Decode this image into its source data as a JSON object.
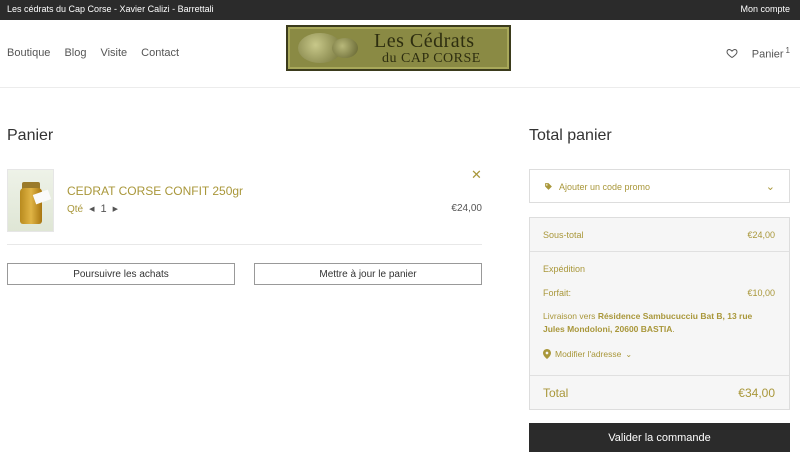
{
  "topbar": {
    "site_title": "Les cédrats du Cap Corse - Xavier Calizi - Barrettali",
    "account_link": "Mon compte"
  },
  "nav": {
    "items": [
      "Boutique",
      "Blog",
      "Visite",
      "Contact"
    ]
  },
  "logo": {
    "line1": "Les Cédrats",
    "line2": "du CAP CORSE"
  },
  "header_right": {
    "cart_label": "Panier",
    "cart_count": "1"
  },
  "cart": {
    "title": "Panier",
    "item": {
      "name": "CEDRAT CORSE CONFIT 250gr",
      "qty_label": "Qté",
      "qty": "1",
      "price": "€24,00"
    },
    "continue_button": "Poursuivre les achats",
    "update_button": "Mettre à jour le panier"
  },
  "totals": {
    "title": "Total panier",
    "promo_label": "Ajouter un code promo",
    "subtotal_label": "Sous-total",
    "subtotal_value": "€24,00",
    "shipping_label": "Expédition",
    "package_label": "Forfait:",
    "package_value": "€10,00",
    "delivery_prefix": "Livraison vers",
    "delivery_address": "Résidence Sambucucciu Bat B, 13 rue Jules Mondoloni, 20600 BASTIA",
    "delivery_suffix": ".",
    "modify_address": "Modifier l'adresse",
    "total_label": "Total",
    "total_value": "€34,00",
    "checkout_button": "Valider la commande"
  },
  "colors": {
    "accent": "#a9973a",
    "dark": "#2b2b2b"
  }
}
